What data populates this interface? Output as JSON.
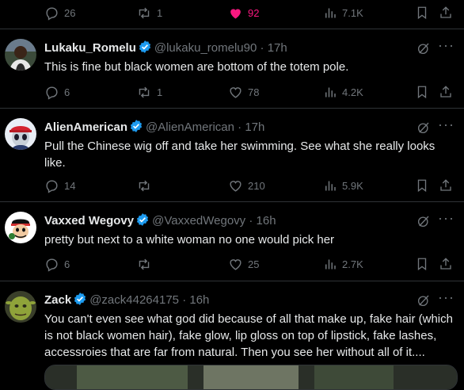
{
  "top_actions": {
    "replies": "26",
    "reposts": "1",
    "likes": "92",
    "views": "7.1K"
  },
  "tweets": [
    {
      "name": "Lukaku_Romelu",
      "handle": "@lukaku_romelu90",
      "sep": "·",
      "time": "17h",
      "text": "This is fine but black women are bottom of the totem pole.",
      "replies": "6",
      "reposts": "1",
      "likes": "78",
      "views": "4.2K"
    },
    {
      "name": "AlienAmerican",
      "handle": "@AlienAmerican",
      "sep": "·",
      "time": "17h",
      "text": "Pull the Chinese wig off and take her swimming.  See what she really looks like.",
      "replies": "14",
      "reposts": "",
      "likes": "210",
      "views": "5.9K"
    },
    {
      "name": "Vaxxed Wegovy",
      "handle": "@VaxxedWegovy",
      "sep": "·",
      "time": "16h",
      "text": "pretty but next to a white woman no one would pick her",
      "replies": "6",
      "reposts": "",
      "likes": "25",
      "views": "2.7K"
    },
    {
      "name": "Zack",
      "handle": "@zack44264175",
      "sep": "·",
      "time": "16h",
      "text": "You can't even see what god did because of all that make up, fake hair (which is not black women hair), fake glow, lip gloss on top of lipstick, fake lashes, accessroies that are far from natural. Then you see her without all of it...."
    }
  ],
  "colors": {
    "background": "#000000",
    "text": "#e7e9ea",
    "muted": "#71767b",
    "like": "#f91880",
    "verified": "#1d9bf0",
    "divider": "#2f3336"
  }
}
